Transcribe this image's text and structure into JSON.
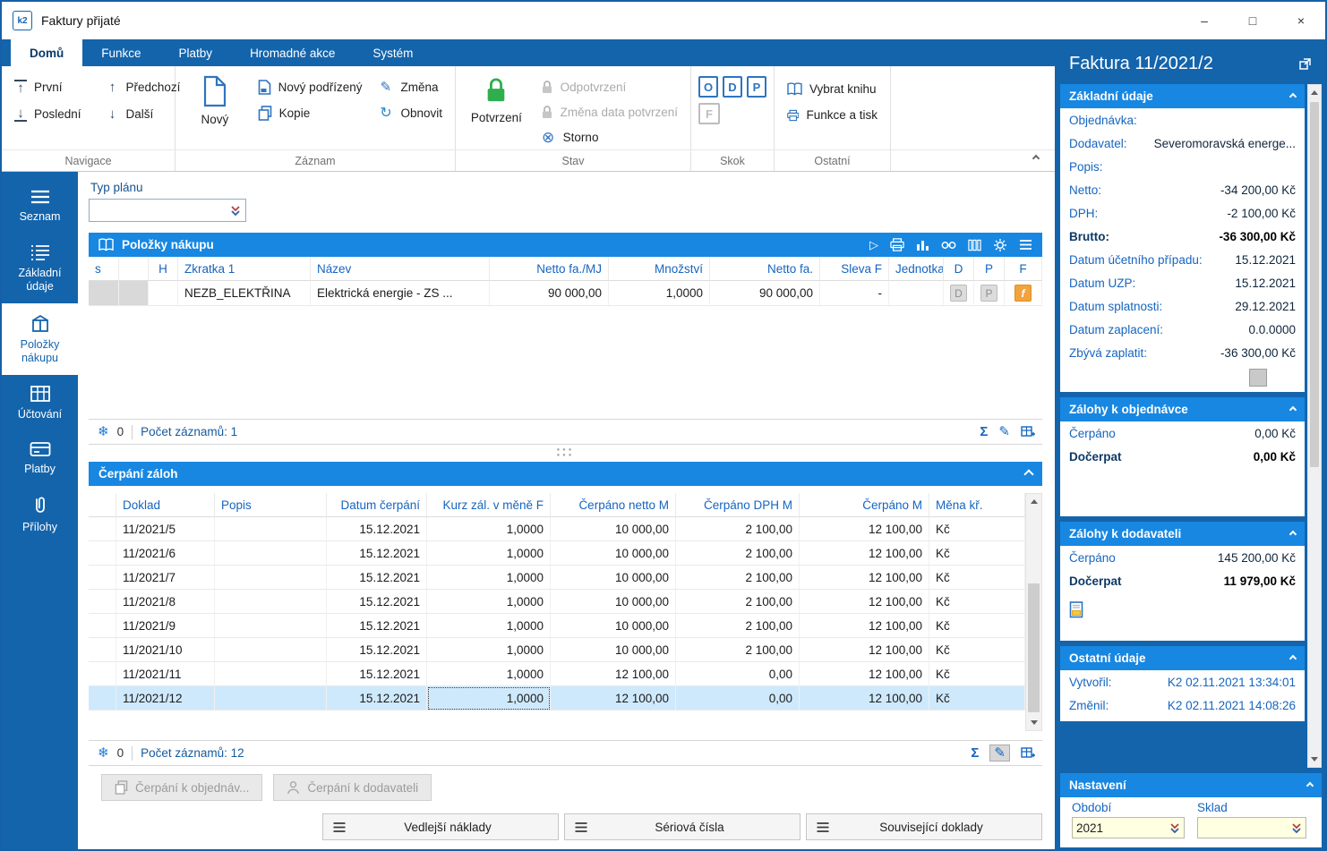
{
  "window": {
    "title": "Faktury přijaté",
    "logo": "k2",
    "minimize": "–",
    "maximize": "□",
    "close": "×"
  },
  "ribbon": {
    "tabs": [
      "Domů",
      "Funkce",
      "Platby",
      "Hromadné akce",
      "Systém"
    ],
    "navigace": {
      "label": "Navigace",
      "prvni": "První",
      "posledni": "Poslední",
      "predchozi": "Předchozí",
      "dalsi": "Další"
    },
    "zaznam": {
      "label": "Záznam",
      "novy": "Nový",
      "novy_podrizeny": "Nový podřízený",
      "kopie": "Kopie",
      "zmena": "Změna",
      "obnovit": "Obnovit"
    },
    "stav": {
      "label": "Stav",
      "potvrzeni": "Potvrzení",
      "odpotvrzeni": "Odpotvrzení",
      "zmena_data": "Změna data potvrzení",
      "storno": "Storno"
    },
    "skok": {
      "label": "Skok",
      "o": "O",
      "d": "D",
      "p": "P",
      "f": "F"
    },
    "ostatni": {
      "label": "Ostatní",
      "vybrat_knihu": "Vybrat knihu",
      "funkce_tisk": "Funkce a tisk"
    }
  },
  "sidebar": {
    "items": [
      {
        "label": "Seznam"
      },
      {
        "label": "Základní údaje"
      },
      {
        "label": "Položky nákupu"
      },
      {
        "label": "Účtování"
      },
      {
        "label": "Platby"
      },
      {
        "label": "Přílohy"
      }
    ]
  },
  "main": {
    "typ_planu_label": "Typ plánu",
    "typ_planu_value": "",
    "polozky": {
      "title": "Položky nákupu",
      "columns": [
        "s",
        "",
        "H",
        "Zkratka 1",
        "Název",
        "Netto fa./MJ",
        "Množství",
        "Netto fa.",
        "Sleva F",
        "Jednotka",
        "D",
        "P",
        "F"
      ],
      "row": {
        "zkratka": "NEZB_ELEKTŘINA",
        "nazev": "Elektrická energie - ZS ...",
        "netto_mj": "90 000,00",
        "mnozstvi": "1,0000",
        "netto": "90 000,00",
        "sleva": "-",
        "jednotka": "",
        "d": "D",
        "p": "P",
        "f": "f"
      },
      "badge": "0",
      "count": "Počet záznamů: 1"
    },
    "cerpani": {
      "title": "Čerpání záloh",
      "columns": [
        "Doklad",
        "Popis",
        "Datum čerpání",
        "Kurz zál. v měně F",
        "Čerpáno netto M",
        "Čerpáno DPH M",
        "Čerpáno M",
        "Měna kř."
      ],
      "rows": [
        {
          "doklad": "11/2021/5",
          "popis": "",
          "datum": "15.12.2021",
          "kurz": "1,0000",
          "netto": "10 000,00",
          "dph": "2 100,00",
          "cerpano": "12 100,00",
          "mena": "Kč"
        },
        {
          "doklad": "11/2021/6",
          "popis": "",
          "datum": "15.12.2021",
          "kurz": "1,0000",
          "netto": "10 000,00",
          "dph": "2 100,00",
          "cerpano": "12 100,00",
          "mena": "Kč"
        },
        {
          "doklad": "11/2021/7",
          "popis": "",
          "datum": "15.12.2021",
          "kurz": "1,0000",
          "netto": "10 000,00",
          "dph": "2 100,00",
          "cerpano": "12 100,00",
          "mena": "Kč"
        },
        {
          "doklad": "11/2021/8",
          "popis": "",
          "datum": "15.12.2021",
          "kurz": "1,0000",
          "netto": "10 000,00",
          "dph": "2 100,00",
          "cerpano": "12 100,00",
          "mena": "Kč"
        },
        {
          "doklad": "11/2021/9",
          "popis": "",
          "datum": "15.12.2021",
          "kurz": "1,0000",
          "netto": "10 000,00",
          "dph": "2 100,00",
          "cerpano": "12 100,00",
          "mena": "Kč"
        },
        {
          "doklad": "11/2021/10",
          "popis": "",
          "datum": "15.12.2021",
          "kurz": "1,0000",
          "netto": "10 000,00",
          "dph": "2 100,00",
          "cerpano": "12 100,00",
          "mena": "Kč"
        },
        {
          "doklad": "11/2021/11",
          "popis": "",
          "datum": "15.12.2021",
          "kurz": "1,0000",
          "netto": "12 100,00",
          "dph": "0,00",
          "cerpano": "12 100,00",
          "mena": "Kč"
        },
        {
          "doklad": "11/2021/12",
          "popis": "",
          "datum": "15.12.2021",
          "kurz": "1,0000",
          "netto": "12 100,00",
          "dph": "0,00",
          "cerpano": "12 100,00",
          "mena": "Kč"
        }
      ],
      "selected_row": "11/2021/12",
      "badge": "0",
      "count": "Počet záznamů: 12"
    },
    "sub_buttons": {
      "objednavka": "Čerpání k objednáv...",
      "dodavatel": "Čerpání k dodavateli"
    },
    "bottom_buttons": {
      "vedlejsi": "Vedlejší náklady",
      "seriova": "Sériová čísla",
      "souvisejici": "Související doklady"
    }
  },
  "panel": {
    "title": "Faktura 11/2021/2",
    "zakladni": {
      "title": "Základní údaje",
      "fields": [
        {
          "label": "Objednávka:",
          "value": ""
        },
        {
          "label": "Dodavatel:",
          "value": "Severomoravská energe..."
        },
        {
          "label": "Popis:",
          "value": ""
        },
        {
          "label": "Netto:",
          "value": "-34 200,00 Kč"
        },
        {
          "label": "DPH:",
          "value": "-2 100,00 Kč"
        },
        {
          "label": "Brutto:",
          "value": "-36 300,00 Kč"
        },
        {
          "label": "Datum účetního případu:",
          "value": "15.12.2021"
        },
        {
          "label": "Datum UZP:",
          "value": "15.12.2021"
        },
        {
          "label": "Datum splatnosti:",
          "value": "29.12.2021"
        },
        {
          "label": "Datum zaplacení:",
          "value": "0.0.0000"
        },
        {
          "label": "Zbývá zaplatit:",
          "value": "-36 300,00 Kč"
        }
      ]
    },
    "zalohy_obj": {
      "title": "Zálohy k objednávce",
      "rows": [
        {
          "label": "Čerpáno",
          "value": "0,00 Kč"
        },
        {
          "label": "Dočerpat",
          "value": "0,00 Kč"
        }
      ]
    },
    "zalohy_dod": {
      "title": "Zálohy k dodavateli",
      "rows": [
        {
          "label": "Čerpáno",
          "value": "145 200,00 Kč"
        },
        {
          "label": "Dočerpat",
          "value": "11 979,00 Kč"
        }
      ]
    },
    "ostatni": {
      "title": "Ostatní údaje",
      "rows": [
        {
          "label": "Vytvořil:",
          "value": "K2 02.11.2021 13:34:01"
        },
        {
          "label": "Změnil:",
          "value": "K2 02.11.2021 14:08:26"
        }
      ]
    },
    "nastaveni": {
      "title": "Nastavení",
      "obdobi_label": "Období",
      "obdobi_value": "2021",
      "sklad_label": "Sklad",
      "sklad_value": ""
    }
  },
  "icons": {
    "snowflake": "❄",
    "sigma": "Σ",
    "pencil": "✎",
    "storno": "⊗",
    "refresh": "↻",
    "arrow_up": "↑",
    "arrow_down": "↓",
    "play": "▷",
    "dots": "●●●"
  },
  "colors": {
    "chrome_blue": "#1464ac",
    "header_blue": "#1787e2",
    "label_blue": "#1565c0",
    "selection": "#cfe9fc",
    "badge_orange": "#f2a33c"
  }
}
